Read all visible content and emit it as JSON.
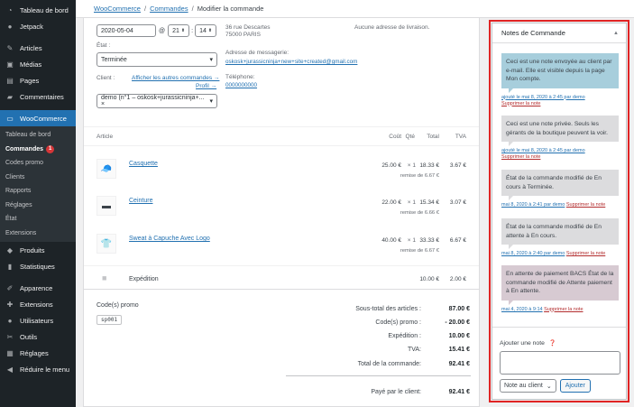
{
  "sidebar": {
    "top_items": [
      {
        "label": "Tableau de bord",
        "icon": "dashboard-icon"
      },
      {
        "label": "Jetpack",
        "icon": "jetpack-icon"
      },
      {
        "label": "Articles",
        "icon": "pin-icon"
      },
      {
        "label": "Médias",
        "icon": "media-icon"
      },
      {
        "label": "Pages",
        "icon": "page-icon"
      },
      {
        "label": "Commentaires",
        "icon": "comment-icon"
      }
    ],
    "active": {
      "label": "WooCommerce",
      "icon": "woocommerce-icon"
    },
    "submenu": [
      "Tableau de bord",
      "Commandes",
      "Codes promo",
      "Clients",
      "Rapports",
      "Réglages",
      "État",
      "Extensions"
    ],
    "orders_badge": "1",
    "bottom_items": [
      {
        "label": "Produits",
        "icon": "product-icon"
      },
      {
        "label": "Statistiques",
        "icon": "chart-icon"
      },
      {
        "label": "Apparence",
        "icon": "brush-icon"
      },
      {
        "label": "Extensions",
        "icon": "plugin-icon"
      },
      {
        "label": "Utilisateurs",
        "icon": "user-icon"
      },
      {
        "label": "Outils",
        "icon": "wrench-icon"
      },
      {
        "label": "Réglages",
        "icon": "settings-icon"
      },
      {
        "label": "Réduire le menu",
        "icon": "collapse-icon"
      }
    ]
  },
  "breadcrumb": {
    "root": "WooCommerce",
    "section": "Commandes",
    "current": "Modifier la commande"
  },
  "order": {
    "date": "2020-05-04",
    "hour": "21",
    "minute": "14",
    "status_label": "État :",
    "status": "Terminée",
    "client_label": "Client :",
    "client_link_1": "Afficher les autres commandes →",
    "client_link_2": "Profil →",
    "client_value": "demo (n°1 – oskosk+jurassicninja+... ×",
    "address_line_1": "36 rue Descartes",
    "address_line_2": "75000 PARIS",
    "email_label": "Adresse de messagerie:",
    "email": "oskosk+jurassicninja+new+site+created@gmail.com",
    "phone_label": "Téléphone:",
    "phone": "0000000000",
    "shipping_note": "Aucune adresse de livraison."
  },
  "items_table": {
    "headers": {
      "item": "Article",
      "cost": "Coût",
      "qty": "Qté",
      "total": "Total",
      "tva": "TVA"
    },
    "rows": [
      {
        "name": "Casquette",
        "cost": "25.00 €",
        "qty": "× 1",
        "total": "18.33 €",
        "discount": "remise de 6.67 €",
        "tva": "3.67 €",
        "icon": "cap-icon"
      },
      {
        "name": "Ceinture",
        "cost": "22.00 €",
        "qty": "× 1",
        "total": "15.34 €",
        "discount": "remise de 6.66 €",
        "tva": "3.07 €",
        "icon": "belt-icon"
      },
      {
        "name": "Sweat à Capuche Avec Logo",
        "cost": "40.00 €",
        "qty": "× 1",
        "total": "33.33 €",
        "discount": "remise de 6.67 €",
        "tva": "6.67 €",
        "icon": "hoodie-icon"
      }
    ],
    "shipping": {
      "label": "Expédition",
      "total": "10.00 €",
      "tva": "2.00 €"
    }
  },
  "coupon": {
    "label": "Code(s) promo",
    "code": "sp001"
  },
  "totals": [
    {
      "label": "Sous-total des articles :",
      "value": "87.00 €"
    },
    {
      "label": "Code(s) promo :",
      "value": "- 20.00 €"
    },
    {
      "label": "Expédition :",
      "value": "10.00 €"
    },
    {
      "label": "TVA:",
      "value": "15.41 €"
    },
    {
      "label": "Total de la commande:",
      "value": "92.41 €"
    }
  ],
  "paid": {
    "label": "Payé par le client:",
    "value": "92.41 €"
  },
  "notes": {
    "title": "Notes de Commande",
    "items": [
      {
        "text": "Ceci est une note envoyée au client par e-mail. Elle est visible depuis la page Mon compte.",
        "meta": "ajouté le mai 8, 2020 à 2:45 par demo",
        "delete": "Supprimer la note",
        "kind": "customer"
      },
      {
        "text": "Ceci est une note privée. Seuls les gérants de la boutique peuvent la voir.",
        "meta": "ajouté le mai 8, 2020 à 2:45 par demo",
        "delete": "Supprimer la note",
        "kind": "private"
      },
      {
        "text": "État de la commande modifié de En cours à Terminée.",
        "meta": "mai 8, 2020 à 2:41 par demo",
        "delete": "Supprimer la note",
        "kind": "private"
      },
      {
        "text": "État de la commande modifié de En attente à En cours.",
        "meta": "mai 8, 2020 à 2:40 par demo",
        "delete": "Supprimer la note",
        "kind": "private"
      },
      {
        "text": "En attente de paiement BACS État de la commande modifié de Attente paiement à En attente.",
        "meta": "mai 4, 2020 à 9:14",
        "delete": "Supprimer la note",
        "kind": "system"
      }
    ],
    "add_label": "Ajouter une note",
    "note_type": "Note au client",
    "add_button": "Ajouter"
  }
}
